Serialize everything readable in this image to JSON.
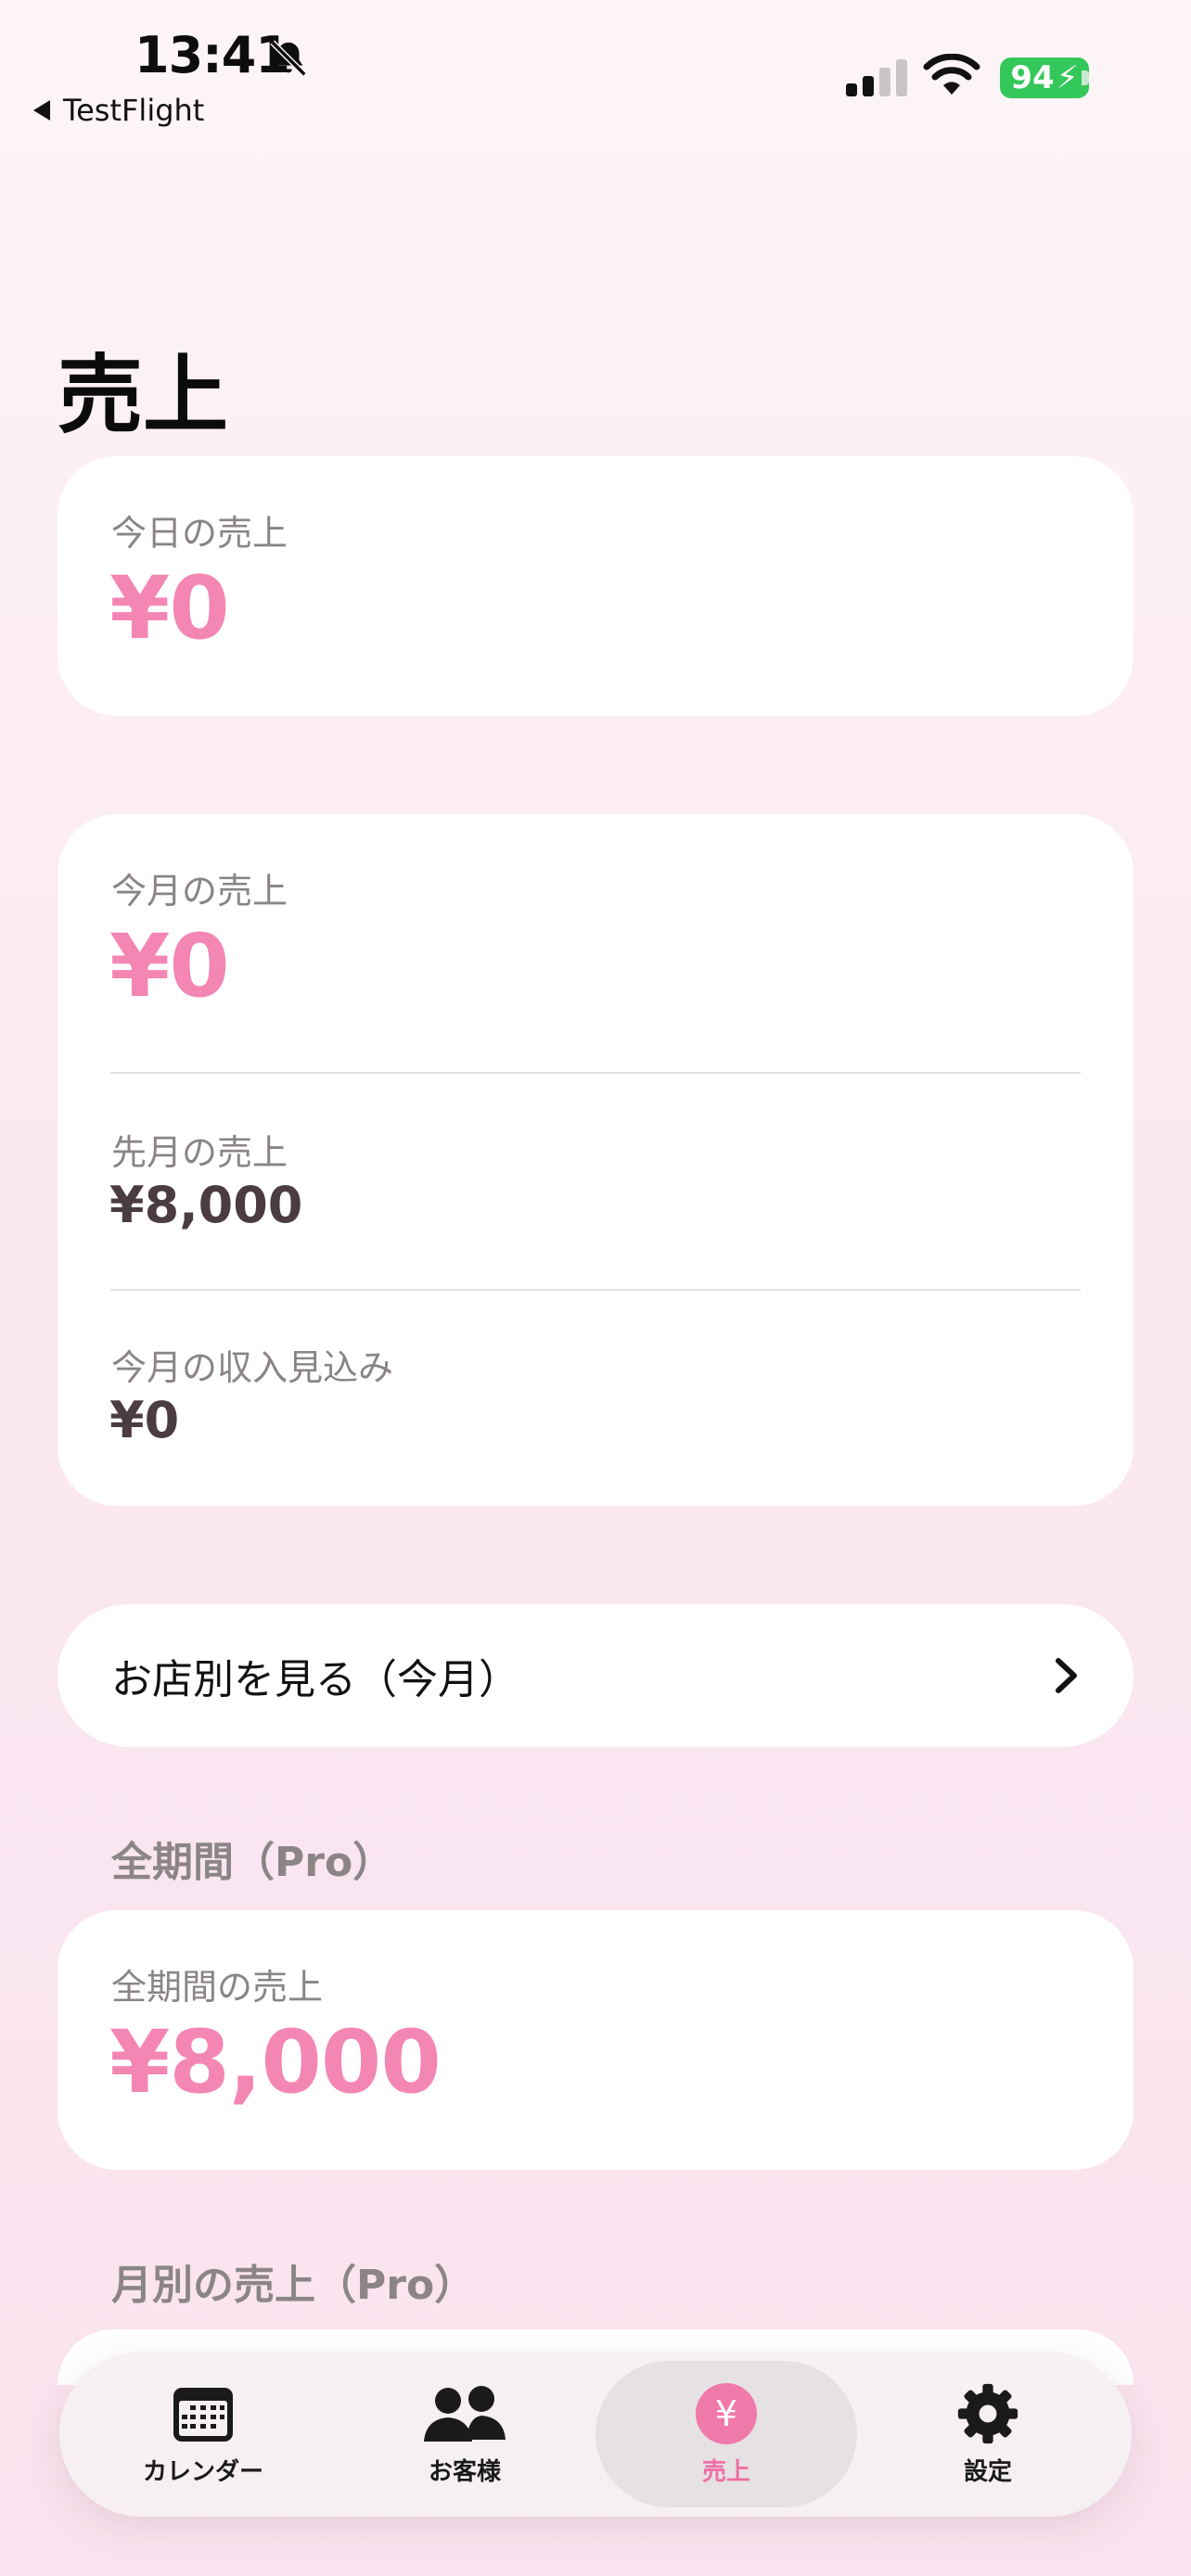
{
  "status_bar": {
    "time": "13:41",
    "back_app": "TestFlight",
    "battery": "94",
    "icons": [
      "bell-slash-icon",
      "signal-icon",
      "wifi-icon",
      "battery-charging-icon"
    ]
  },
  "page": {
    "title": "売上"
  },
  "today_card": {
    "label": "今日の売上",
    "value": "¥0"
  },
  "month_card": {
    "current": {
      "label": "今月の売上",
      "value": "¥0"
    },
    "previous": {
      "label": "先月の売上",
      "value": "¥8,000"
    },
    "forecast": {
      "label": "今月の収入見込み",
      "value": "¥0"
    }
  },
  "store_row": {
    "label": "お店別を見る（今月）",
    "icon": "chevron-right-icon"
  },
  "all_period": {
    "header": "全期間（Pro）",
    "label": "全期間の売上",
    "value": "¥8,000"
  },
  "monthly": {
    "header": "月別の売上（Pro）"
  },
  "tabs": [
    {
      "label": "カレンダー",
      "icon": "calendar-icon"
    },
    {
      "label": "お客様",
      "icon": "people-icon"
    },
    {
      "label": "売上",
      "icon": "yen-icon",
      "active": true
    },
    {
      "label": "設定",
      "icon": "gear-icon"
    }
  ],
  "colors": {
    "accent": "#f486b3",
    "battery": "#34c759",
    "value_dark": "#4b3c41"
  }
}
